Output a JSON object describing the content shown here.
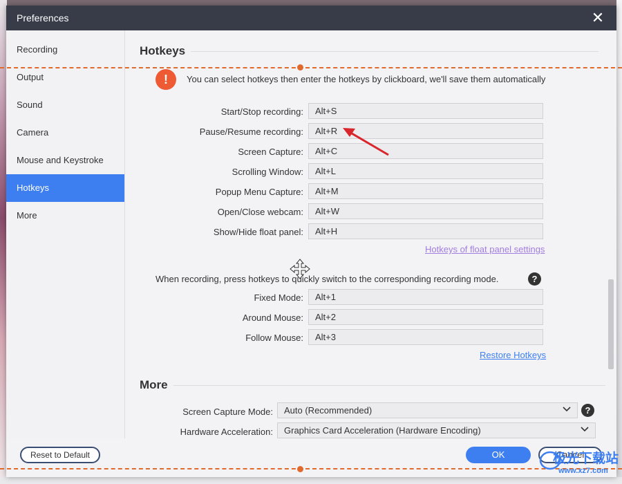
{
  "window": {
    "title": "Preferences"
  },
  "sidebar": {
    "items": [
      {
        "label": "Recording"
      },
      {
        "label": "Output"
      },
      {
        "label": "Sound"
      },
      {
        "label": "Camera"
      },
      {
        "label": "Mouse and Keystroke"
      },
      {
        "label": "Hotkeys",
        "active": true
      },
      {
        "label": "More"
      }
    ]
  },
  "hotkeys": {
    "title": "Hotkeys",
    "notice": "You can select hotkeys then enter the hotkeys by clickboard, we'll save them automatically",
    "rows": [
      {
        "label": "Start/Stop recording:",
        "value": "Alt+S"
      },
      {
        "label": "Pause/Resume recording:",
        "value": "Alt+R"
      },
      {
        "label": "Screen Capture:",
        "value": "Alt+C"
      },
      {
        "label": "Scrolling Window:",
        "value": "Alt+L"
      },
      {
        "label": "Popup Menu Capture:",
        "value": "Alt+M"
      },
      {
        "label": "Open/Close webcam:",
        "value": "Alt+W"
      },
      {
        "label": "Show/Hide float panel:",
        "value": "Alt+H"
      }
    ],
    "float_panel_link": "Hotkeys of float panel settings",
    "mode_hint": "When recording, press hotkeys to quickly switch to the corresponding recording mode.",
    "mode_rows": [
      {
        "label": "Fixed Mode:",
        "value": "Alt+1"
      },
      {
        "label": "Around Mouse:",
        "value": "Alt+2"
      },
      {
        "label": "Follow Mouse:",
        "value": "Alt+3"
      }
    ],
    "restore_link": "Restore Hotkeys"
  },
  "more": {
    "title": "More",
    "screen_capture_mode": {
      "label": "Screen Capture Mode:",
      "value": "Auto (Recommended)"
    },
    "hardware_acceleration": {
      "label": "Hardware Acceleration:",
      "value": "Graphics Card Acceleration (Hardware Encoding)"
    }
  },
  "footer": {
    "reset_label": "Reset to Default",
    "ok_label": "OK",
    "cancel_label": "Cancel"
  },
  "watermark": {
    "text": "极光下载站",
    "url": "www.xz7.com"
  },
  "colors": {
    "accent": "#3d7ff0",
    "titlebar": "#373c48",
    "warning": "#ed5a34",
    "annotation": "#e06a2c",
    "arrow": "#d9262c"
  },
  "icons": {
    "close": "close-icon",
    "warning": "exclamation-icon",
    "help": "question-icon",
    "dropdown": "chevron-down-icon",
    "move": "move-cursor-icon"
  }
}
